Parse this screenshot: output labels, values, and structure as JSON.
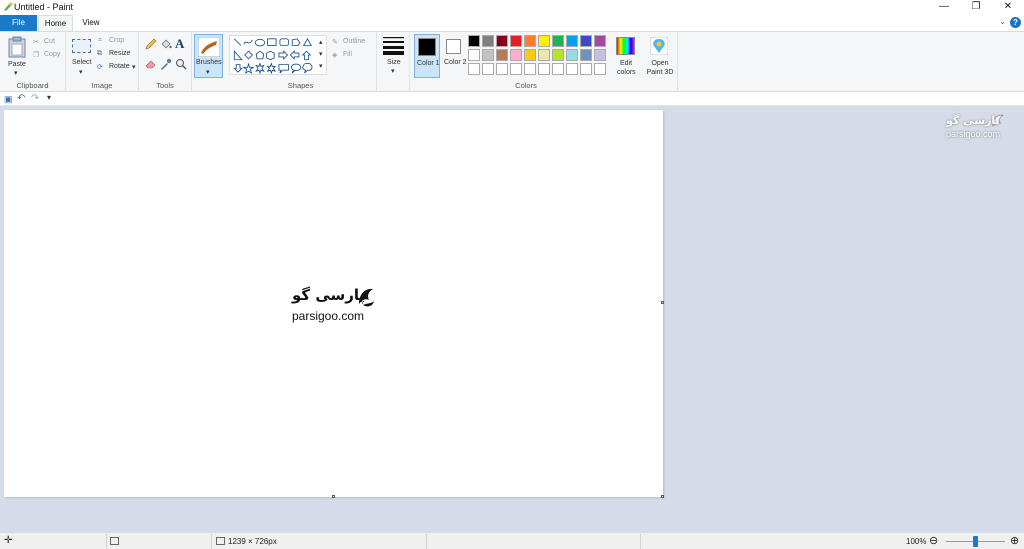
{
  "window": {
    "title": "Untitled - Paint",
    "minimize": "—",
    "restore": "❐",
    "close": "✕"
  },
  "tabs": {
    "file": "File",
    "home": "Home",
    "view": "View",
    "help": "?"
  },
  "ribbon": {
    "clipboard": {
      "group": "Clipboard",
      "paste": "Paste",
      "cut": "Cut",
      "copy": "Copy"
    },
    "image": {
      "group": "Image",
      "select": "Select",
      "crop": "Crop",
      "resize": "Resize",
      "rotate": "Rotate"
    },
    "tools": {
      "group": "Tools"
    },
    "brushes": {
      "label": "Brushes"
    },
    "shapes": {
      "group": "Shapes",
      "outline": "Outline",
      "fill": "Fill"
    },
    "size": {
      "label": "Size"
    },
    "colors": {
      "group": "Colors",
      "color1": "Color 1",
      "color2": "Color 2",
      "edit": "Edit colors",
      "paint3d": "Open Paint 3D",
      "color1_value": "#000000",
      "color2_value": "#ffffff",
      "palette_row1": [
        "#000000",
        "#7f7f7f",
        "#880015",
        "#ed1c24",
        "#ff7f27",
        "#fff200",
        "#22b14c",
        "#00a2e8",
        "#3f48cc",
        "#a349a4"
      ],
      "palette_row2": [
        "#ffffff",
        "#c3c3c3",
        "#b97a57",
        "#ffaec9",
        "#ffc90e",
        "#efe4b0",
        "#b5e61d",
        "#99d9ea",
        "#7092be",
        "#c8bfe7"
      ]
    }
  },
  "canvas": {
    "logo_fa": "پارسی گو",
    "logo_en": "parsigoo.com"
  },
  "watermark": {
    "fa": "پارسی گو",
    "en": "parsigoo.com"
  },
  "status": {
    "dimensions": "1239 × 726px",
    "zoom": "100%",
    "zoom_level": 0.5
  }
}
